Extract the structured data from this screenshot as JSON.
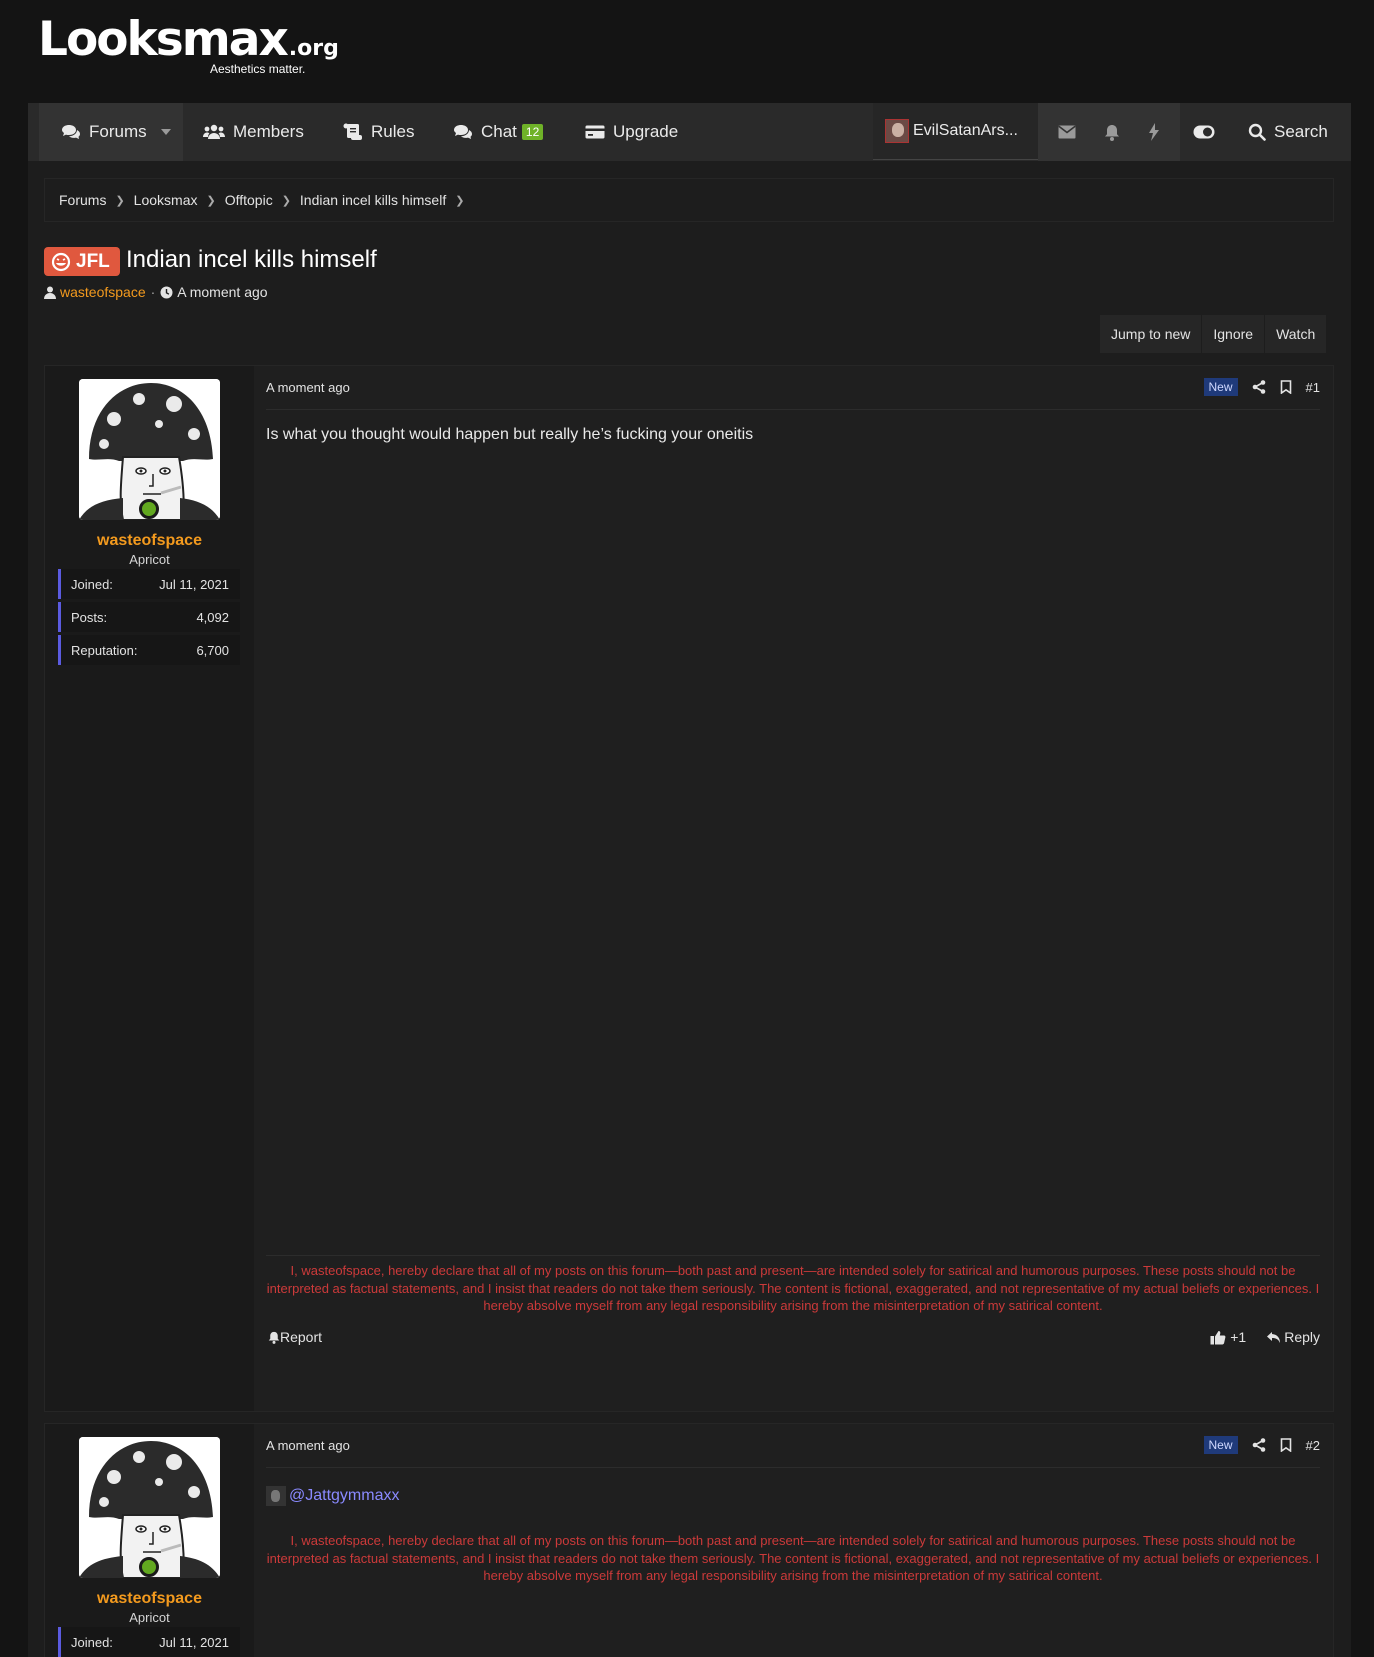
{
  "site": {
    "logo_main": "Looksmax",
    "logo_tld": ".org",
    "tagline": "Aesthetics matter."
  },
  "nav": {
    "forums": "Forums",
    "members": "Members",
    "rules": "Rules",
    "chat": "Chat",
    "chat_count": "12",
    "upgrade": "Upgrade",
    "user": "EvilSatanArs...",
    "search": "Search"
  },
  "breadcrumb": [
    "Forums",
    "Looksmax",
    "Offtopic",
    "Indian incel kills himself"
  ],
  "thread": {
    "prefix": "JFL",
    "title": "Indian incel kills himself",
    "author": "wasteofspace",
    "time": "A moment ago",
    "buttons": [
      "Jump to new",
      "Ignore",
      "Watch"
    ]
  },
  "posts": [
    {
      "username": "wasteofspace",
      "user_title": "Apricot",
      "stats": [
        {
          "label": "Joined:",
          "value": "Jul 11, 2021"
        },
        {
          "label": "Posts:",
          "value": "4,092"
        },
        {
          "label": "Reputation:",
          "value": "6,700"
        }
      ],
      "time": "A moment ago",
      "badge": "New",
      "number": "#1",
      "body": "Is what you thought would happen but really he’s fucking your oneitis",
      "signature": "I, wasteofspace, hereby declare that all of my posts on this forum—both past and present—are intended solely for satirical and humorous purposes. These posts should not be interpreted as factual statements, and I insist that readers do not take them seriously. The content is fictional, exaggerated, and not representative of my actual beliefs or experiences. I hereby absolve myself from any legal responsibility arising from the misinterpretation of my satirical content.",
      "report": "Report",
      "like_count": "+1",
      "reply": "Reply"
    },
    {
      "username": "wasteofspace",
      "user_title": "Apricot",
      "stats": [
        {
          "label": "Joined:",
          "value": "Jul 11, 2021"
        }
      ],
      "time": "A moment ago",
      "badge": "New",
      "number": "#2",
      "mention": "@Jattgymmaxx",
      "signature": "I, wasteofspace, hereby declare that all of my posts on this forum—both past and present—are intended solely for satirical and humorous purposes. These posts should not be interpreted as factual statements, and I insist that readers do not take them seriously. The content is fictional, exaggerated, and not representative of my actual beliefs or experiences. I hereby absolve myself from any legal responsibility arising from the misinterpretation of my satirical content."
    }
  ],
  "colors": {
    "accent_orange": "#f39a1e",
    "online_green": "#62a820",
    "signature_red": "#cc3a3a",
    "jfl_prefix": "#e0583e",
    "stat_border": "#5b5be0"
  },
  "icons": {
    "forums": "comments-icon",
    "members": "users-icon",
    "rules": "scroll-icon",
    "chat": "chat-icon",
    "upgrade": "credit-card-icon",
    "inbox": "envelope-icon",
    "alerts": "bell-icon",
    "whats_new": "bolt-icon",
    "style": "toggle-icon",
    "search": "search-icon"
  }
}
